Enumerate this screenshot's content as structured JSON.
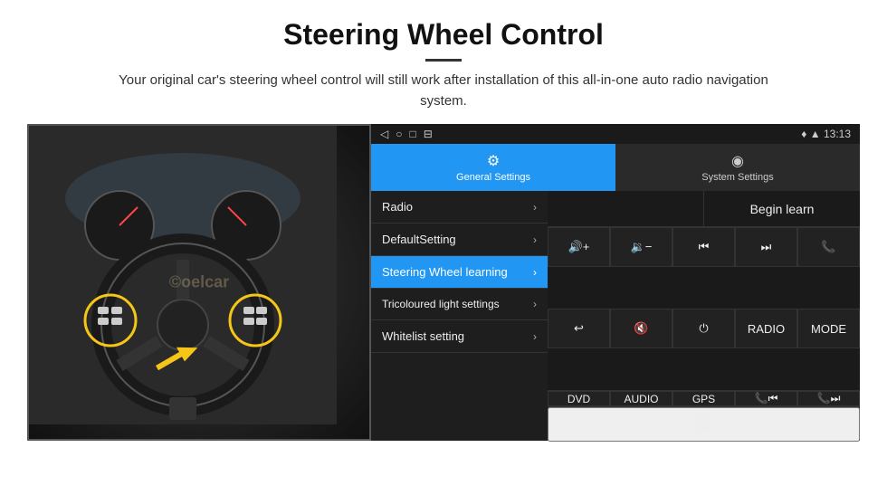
{
  "header": {
    "title": "Steering Wheel Control",
    "divider": true,
    "subtitle": "Your original car's steering wheel control will still work after installation of this all-in-one auto radio navigation system."
  },
  "android": {
    "status_bar": {
      "nav_icons": [
        "◁",
        "○",
        "□",
        "⊟"
      ],
      "right_info": "♦ ▲  13:13"
    },
    "tabs": [
      {
        "id": "general",
        "label": "General Settings",
        "icon": "⚙",
        "active": true
      },
      {
        "id": "system",
        "label": "System Settings",
        "icon": "◉",
        "active": false
      }
    ],
    "menu_items": [
      {
        "id": "radio",
        "label": "Radio",
        "active": false
      },
      {
        "id": "default",
        "label": "DefaultSetting",
        "active": false
      },
      {
        "id": "steering",
        "label": "Steering Wheel learning",
        "active": true
      },
      {
        "id": "tricoloured",
        "label": "Tricoloured light settings",
        "active": false
      },
      {
        "id": "whitelist",
        "label": "Whitelist setting",
        "active": false
      }
    ],
    "begin_learn_label": "Begin learn",
    "control_buttons_row1": [
      {
        "id": "vol-up",
        "label": "🔊+"
      },
      {
        "id": "vol-down",
        "label": "🔉−"
      },
      {
        "id": "prev-track",
        "label": "⏮"
      },
      {
        "id": "next-track",
        "label": "⏭"
      },
      {
        "id": "phone",
        "label": "📞"
      }
    ],
    "control_buttons_row2": [
      {
        "id": "hang-up",
        "label": "↩"
      },
      {
        "id": "mute",
        "label": "🔇"
      },
      {
        "id": "power",
        "label": "⏻"
      },
      {
        "id": "radio-btn",
        "label": "RADIO"
      },
      {
        "id": "mode",
        "label": "MODE"
      }
    ],
    "bottom_buttons": [
      {
        "id": "dvd",
        "label": "DVD"
      },
      {
        "id": "audio",
        "label": "AUDIO"
      },
      {
        "id": "gps",
        "label": "GPS"
      },
      {
        "id": "phone-prev",
        "label": "📞⏮"
      },
      {
        "id": "phone-next",
        "label": "📞⏭"
      }
    ],
    "last_row_icon": "🖥"
  },
  "image": {
    "watermark": "©oelcar"
  }
}
